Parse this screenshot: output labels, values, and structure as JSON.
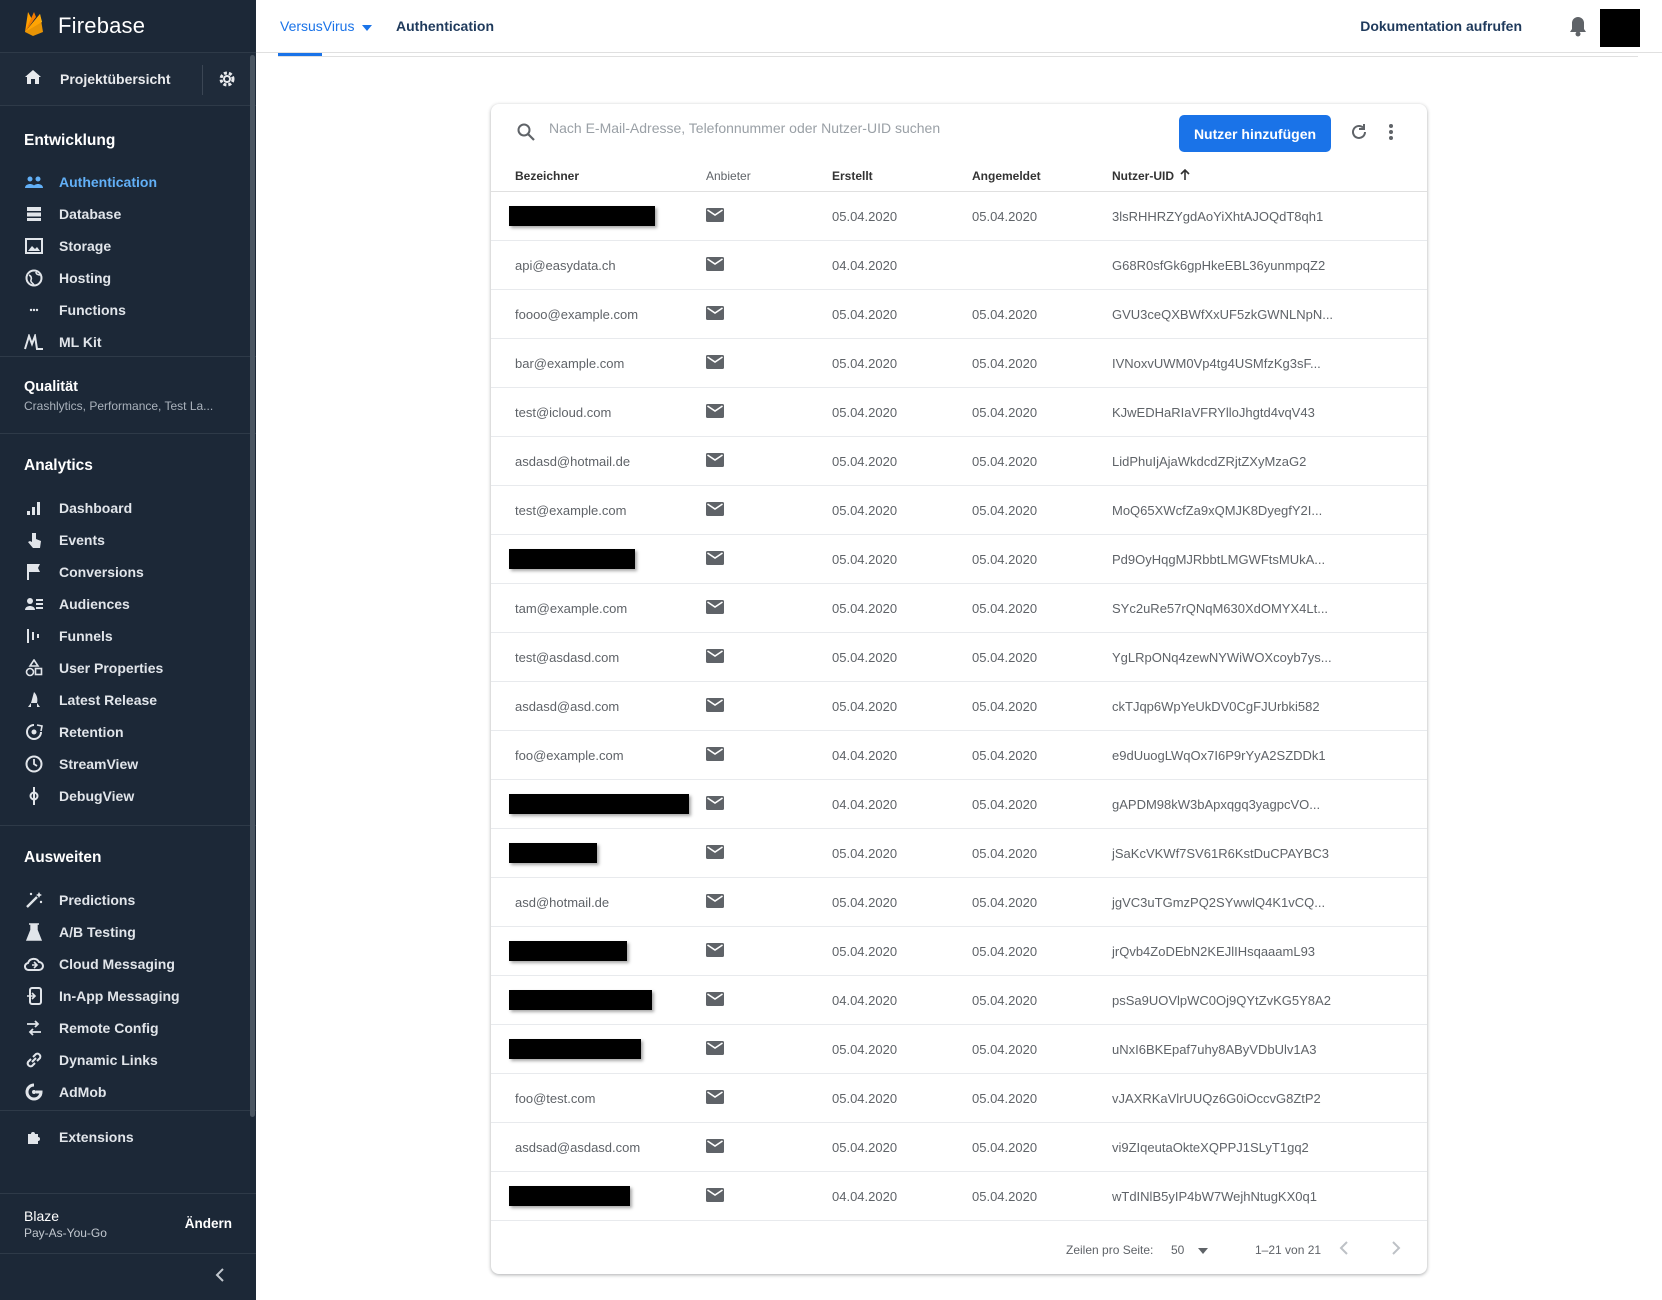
{
  "brand": {
    "name": "Firebase"
  },
  "project_overview": {
    "label": "Projektübersicht"
  },
  "sections": {
    "develop": {
      "title": "Entwicklung",
      "items": [
        {
          "label": "Authentication",
          "icon": "people-icon",
          "active": true
        },
        {
          "label": "Database",
          "icon": "database-icon"
        },
        {
          "label": "Storage",
          "icon": "image-icon"
        },
        {
          "label": "Hosting",
          "icon": "globe-icon"
        },
        {
          "label": "Functions",
          "icon": "functions-icon"
        },
        {
          "label": "ML Kit",
          "icon": "mlkit-icon"
        }
      ]
    },
    "quality": {
      "title": "Qualität",
      "subtitle": "Crashlytics, Performance, Test La..."
    },
    "analytics": {
      "title": "Analytics",
      "items": [
        {
          "label": "Dashboard",
          "icon": "bar-chart-icon"
        },
        {
          "label": "Events",
          "icon": "touch-icon"
        },
        {
          "label": "Conversions",
          "icon": "flag-icon"
        },
        {
          "label": "Audiences",
          "icon": "audience-icon"
        },
        {
          "label": "Funnels",
          "icon": "funnel-icon"
        },
        {
          "label": "User Properties",
          "icon": "shapes-icon"
        },
        {
          "label": "Latest Release",
          "icon": "rocket-icon"
        },
        {
          "label": "Retention",
          "icon": "retention-icon"
        },
        {
          "label": "StreamView",
          "icon": "clock-icon"
        },
        {
          "label": "DebugView",
          "icon": "debug-icon"
        }
      ]
    },
    "grow": {
      "title": "Ausweiten",
      "items": [
        {
          "label": "Predictions",
          "icon": "wand-icon"
        },
        {
          "label": "A/B Testing",
          "icon": "flask-icon"
        },
        {
          "label": "Cloud Messaging",
          "icon": "cloud-icon"
        },
        {
          "label": "In-App Messaging",
          "icon": "inapp-icon"
        },
        {
          "label": "Remote Config",
          "icon": "remote-config-icon"
        },
        {
          "label": "Dynamic Links",
          "icon": "link-icon"
        },
        {
          "label": "AdMob",
          "icon": "admob-icon"
        }
      ]
    },
    "extensions": {
      "label": "Extensions",
      "icon": "extensions-icon"
    }
  },
  "plan": {
    "name": "Blaze",
    "type": "Pay-As-You-Go",
    "change_label": "Ändern"
  },
  "topbar": {
    "project": "VersusVirus",
    "breadcrumb": "Authentication",
    "docs_label": "Dokumentation aufrufen"
  },
  "search": {
    "placeholder": "Nach E-Mail-Adresse, Telefonnummer oder Nutzer-UID suchen"
  },
  "toolbar": {
    "add_user_label": "Nutzer hinzufügen"
  },
  "table": {
    "columns": {
      "identifier": "Bezeichner",
      "provider": "Anbieter",
      "created": "Erstellt",
      "signed_in": "Angemeldet",
      "uid": "Nutzer-UID"
    },
    "rows": [
      {
        "identifier": "",
        "redacted": true,
        "created": "05.04.2020",
        "signed_in": "05.04.2020",
        "uid": "3lsRHHRZYgdAoYiXhtAJOQdT8qh1"
      },
      {
        "identifier": "api@easydata.ch",
        "created": "04.04.2020",
        "signed_in": "",
        "uid": "G68R0sfGk6gpHkeEBL36yunmpqZ2"
      },
      {
        "identifier": "foooo@example.com",
        "created": "05.04.2020",
        "signed_in": "05.04.2020",
        "uid": "GVU3ceQXBWfXxUF5zkGWNLNpN..."
      },
      {
        "identifier": "bar@example.com",
        "created": "05.04.2020",
        "signed_in": "05.04.2020",
        "uid": "IVNoxvUWM0Vp4tg4USMfzKg3sF..."
      },
      {
        "identifier": "test@icloud.com",
        "created": "05.04.2020",
        "signed_in": "05.04.2020",
        "uid": "KJwEDHaRIaVFRYlloJhgtd4vqV43"
      },
      {
        "identifier": "asdasd@hotmail.de",
        "created": "05.04.2020",
        "signed_in": "05.04.2020",
        "uid": "LidPhuIjAjaWkdcdZRjtZXyMzaG2"
      },
      {
        "identifier": "test@example.com",
        "created": "05.04.2020",
        "signed_in": "05.04.2020",
        "uid": "MoQ65XWcfZa9xQMJK8DyegfY2I..."
      },
      {
        "identifier": "",
        "redacted": true,
        "created": "05.04.2020",
        "signed_in": "05.04.2020",
        "uid": "Pd9OyHqgMJRbbtLMGWFtsMUkA..."
      },
      {
        "identifier": "tam@example.com",
        "created": "05.04.2020",
        "signed_in": "05.04.2020",
        "uid": "SYc2uRe57rQNqM630XdOMYX4Lt..."
      },
      {
        "identifier": "test@asdasd.com",
        "created": "05.04.2020",
        "signed_in": "05.04.2020",
        "uid": "YgLRpONq4zewNYWiWOXcoyb7ys..."
      },
      {
        "identifier": "asdasd@asd.com",
        "created": "05.04.2020",
        "signed_in": "05.04.2020",
        "uid": "ckTJqp6WpYeUkDV0CgFJUrbki582"
      },
      {
        "identifier": "foo@example.com",
        "created": "04.04.2020",
        "signed_in": "05.04.2020",
        "uid": "e9dUuogLWqOx7I6P9rYyA2SZDDk1"
      },
      {
        "identifier": "",
        "redacted": true,
        "created": "04.04.2020",
        "signed_in": "05.04.2020",
        "uid": "gAPDM98kW3bApxqgq3yagpcVO..."
      },
      {
        "identifier": "",
        "redacted": true,
        "created": "05.04.2020",
        "signed_in": "05.04.2020",
        "uid": "jSaKcVKWf7SV61R6KstDuCPAYBC3"
      },
      {
        "identifier": "asd@hotmail.de",
        "created": "05.04.2020",
        "signed_in": "05.04.2020",
        "uid": "jgVC3uTGmzPQ2SYwwlQ4K1vCQ..."
      },
      {
        "identifier": "",
        "redacted": true,
        "created": "05.04.2020",
        "signed_in": "05.04.2020",
        "uid": "jrQvb4ZoDEbN2KEJlIHsqaaamL93"
      },
      {
        "identifier": "",
        "redacted": true,
        "created": "04.04.2020",
        "signed_in": "05.04.2020",
        "uid": "psSa9UOVlpWC0Oj9QYtZvKG5Y8A2"
      },
      {
        "identifier": "",
        "redacted": true,
        "created": "05.04.2020",
        "signed_in": "05.04.2020",
        "uid": "uNxI6BKEpaf7uhy8AByVDbUlv1A3"
      },
      {
        "identifier": "foo@test.com",
        "created": "05.04.2020",
        "signed_in": "05.04.2020",
        "uid": "vJAXRKaVlrUUQz6G0iOccvG8ZtP2"
      },
      {
        "identifier": "asdsad@asdasd.com",
        "created": "05.04.2020",
        "signed_in": "05.04.2020",
        "uid": "vi9ZIqeutaOkteXQPPJ1SLyT1gq2"
      },
      {
        "identifier": "",
        "redacted": true,
        "created": "04.04.2020",
        "signed_in": "05.04.2020",
        "uid": "wTdINlB5yIP4bW7WejhNtugKX0q1"
      }
    ]
  },
  "pagination": {
    "rows_per_page_label": "Zeilen pro Seite:",
    "rows_per_page": "50",
    "range": "1–21 von 21"
  },
  "colors": {
    "sidebar_bg": "#1c2837",
    "accent": "#1a73e8",
    "active_nav": "#62b0f7"
  }
}
